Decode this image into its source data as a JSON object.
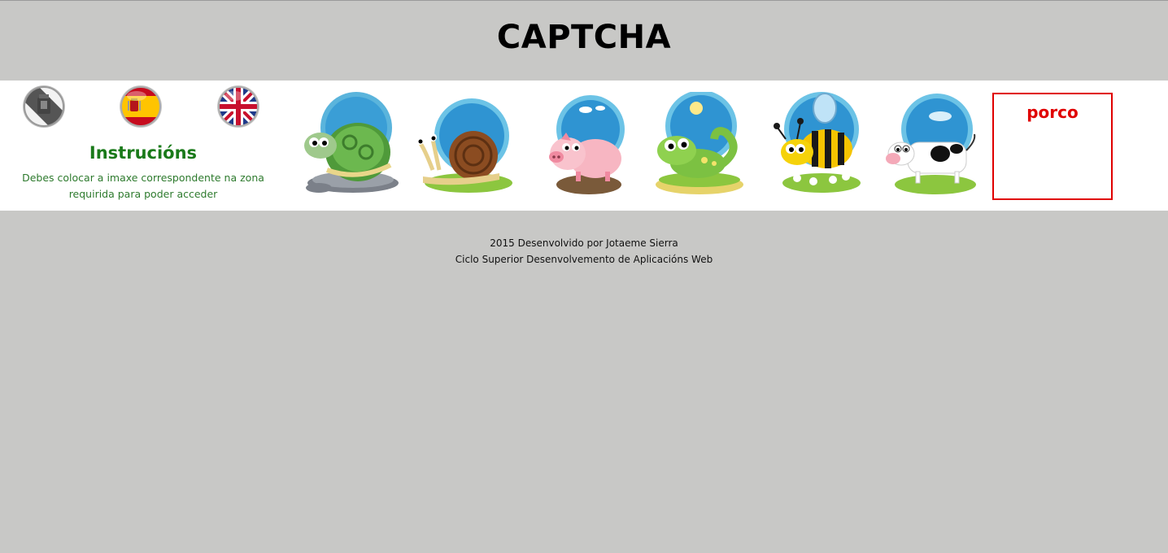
{
  "header": {
    "title": "CAPTCHA"
  },
  "languages": [
    {
      "name": "Galego",
      "icon": "galicia-flag-icon"
    },
    {
      "name": "Español",
      "icon": "spain-flag-icon"
    },
    {
      "name": "English",
      "icon": "uk-flag-icon"
    }
  ],
  "instructions": {
    "title": "Instrucións",
    "text": "Debes colocar a imaxe correspondente na zona requirida para poder acceder"
  },
  "animals": [
    {
      "name": "turtle",
      "icon": "turtle-icon"
    },
    {
      "name": "snail",
      "icon": "snail-icon"
    },
    {
      "name": "pig",
      "icon": "pig-icon"
    },
    {
      "name": "chameleon",
      "icon": "chameleon-icon"
    },
    {
      "name": "bee",
      "icon": "bee-icon"
    },
    {
      "name": "cow",
      "icon": "cow-icon"
    }
  ],
  "target": {
    "word": "porco",
    "color": "#e00000"
  },
  "footer": {
    "line1": "2015 Desenvolvido por Jotaeme Sierra",
    "line2": "Ciclo Superior Desenvolvemento de Aplicacións Web"
  },
  "colors": {
    "background": "#c8c8c6",
    "instructions": "#1a7a1a",
    "target": "#e00000"
  }
}
